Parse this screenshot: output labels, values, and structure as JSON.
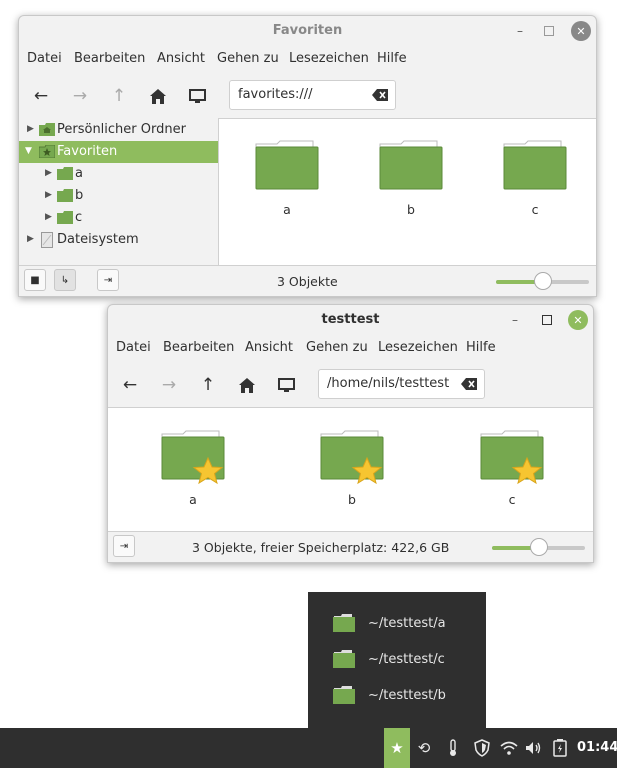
{
  "window_favorites": {
    "title": "Favoriten",
    "menu": [
      "Datei",
      "Bearbeiten",
      "Ansicht",
      "Gehen zu",
      "Lesezeichen",
      "Hilfe"
    ],
    "path": "favorites:///",
    "sidebar": [
      {
        "label": "Persönlicher Ordner",
        "icon": "home-folder-icon"
      },
      {
        "label": "Favoriten",
        "icon": "favorites-folder-icon",
        "selected": true
      },
      {
        "label": "a",
        "icon": "folder-icon"
      },
      {
        "label": "b",
        "icon": "folder-icon"
      },
      {
        "label": "c",
        "icon": "folder-icon"
      },
      {
        "label": "Dateisystem",
        "icon": "drive-icon"
      }
    ],
    "items": [
      "a",
      "b",
      "c"
    ],
    "status": "3 Objekte",
    "zoom_level": 0.5
  },
  "window_testtest": {
    "title": "testtest",
    "menu": [
      "Datei",
      "Bearbeiten",
      "Ansicht",
      "Gehen zu",
      "Lesezeichen",
      "Hilfe"
    ],
    "path": "/home/nils/testtest",
    "items": [
      "a",
      "b",
      "c"
    ],
    "status": "3 Objekte, freier Speicherplatz: 422,6 GB",
    "zoom_level": 0.5
  },
  "favorites_popup": {
    "items": [
      "~/testtest/a",
      "~/testtest/c",
      "~/testtest/b"
    ]
  },
  "taskbar": {
    "clock": "01:44",
    "tray_icons": [
      "favorites-star-icon",
      "history-icon",
      "temperature-icon",
      "shield-icon",
      "wifi-icon",
      "volume-icon",
      "battery-icon"
    ]
  },
  "colors": {
    "accent": "#8fbc5e",
    "folder": "#76a84f",
    "taskbar": "#2f2f2f"
  }
}
